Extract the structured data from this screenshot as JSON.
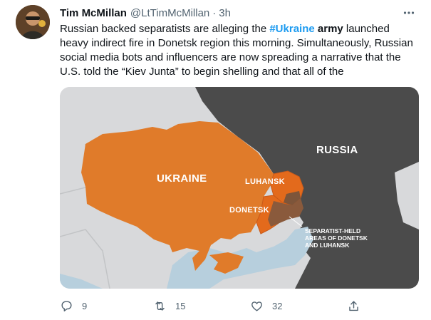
{
  "tweet": {
    "author": {
      "display_name": "Tim McMillan",
      "handle": "@LtTimMcMillan",
      "separator": "·",
      "time": "3h"
    },
    "text": {
      "part1": "Russian backed separatists are alleging the ",
      "hashtag": "#Ukraine",
      "bold_word": "army",
      "part2": " launched heavy indirect fire in Donetsk region this morning. Simultaneously, Russian social media bots and influencers are now spreading a narrative that the U.S. told the “Kiev Junta” to begin shelling and that all of the"
    },
    "map": {
      "label_ukraine": "UKRAINE",
      "label_russia": "RUSSIA",
      "label_luhansk": "LUHANSK",
      "label_donetsk": "DONETSK",
      "label_separatist": "SEPARATIST-HELD AREAS OF DONETSK AND LUHANSK",
      "colors": {
        "ukraine": "#e07b2a",
        "russia": "#4a4a4a",
        "separatist": "#8a5a3c",
        "sea": "#b9cfdd",
        "land_other": "#d6d6d6"
      }
    },
    "actions": {
      "reply_count": "9",
      "retweet_count": "15",
      "like_count": "32"
    }
  },
  "theme": {
    "accent": "#1d9bf0",
    "muted": "#536471"
  }
}
